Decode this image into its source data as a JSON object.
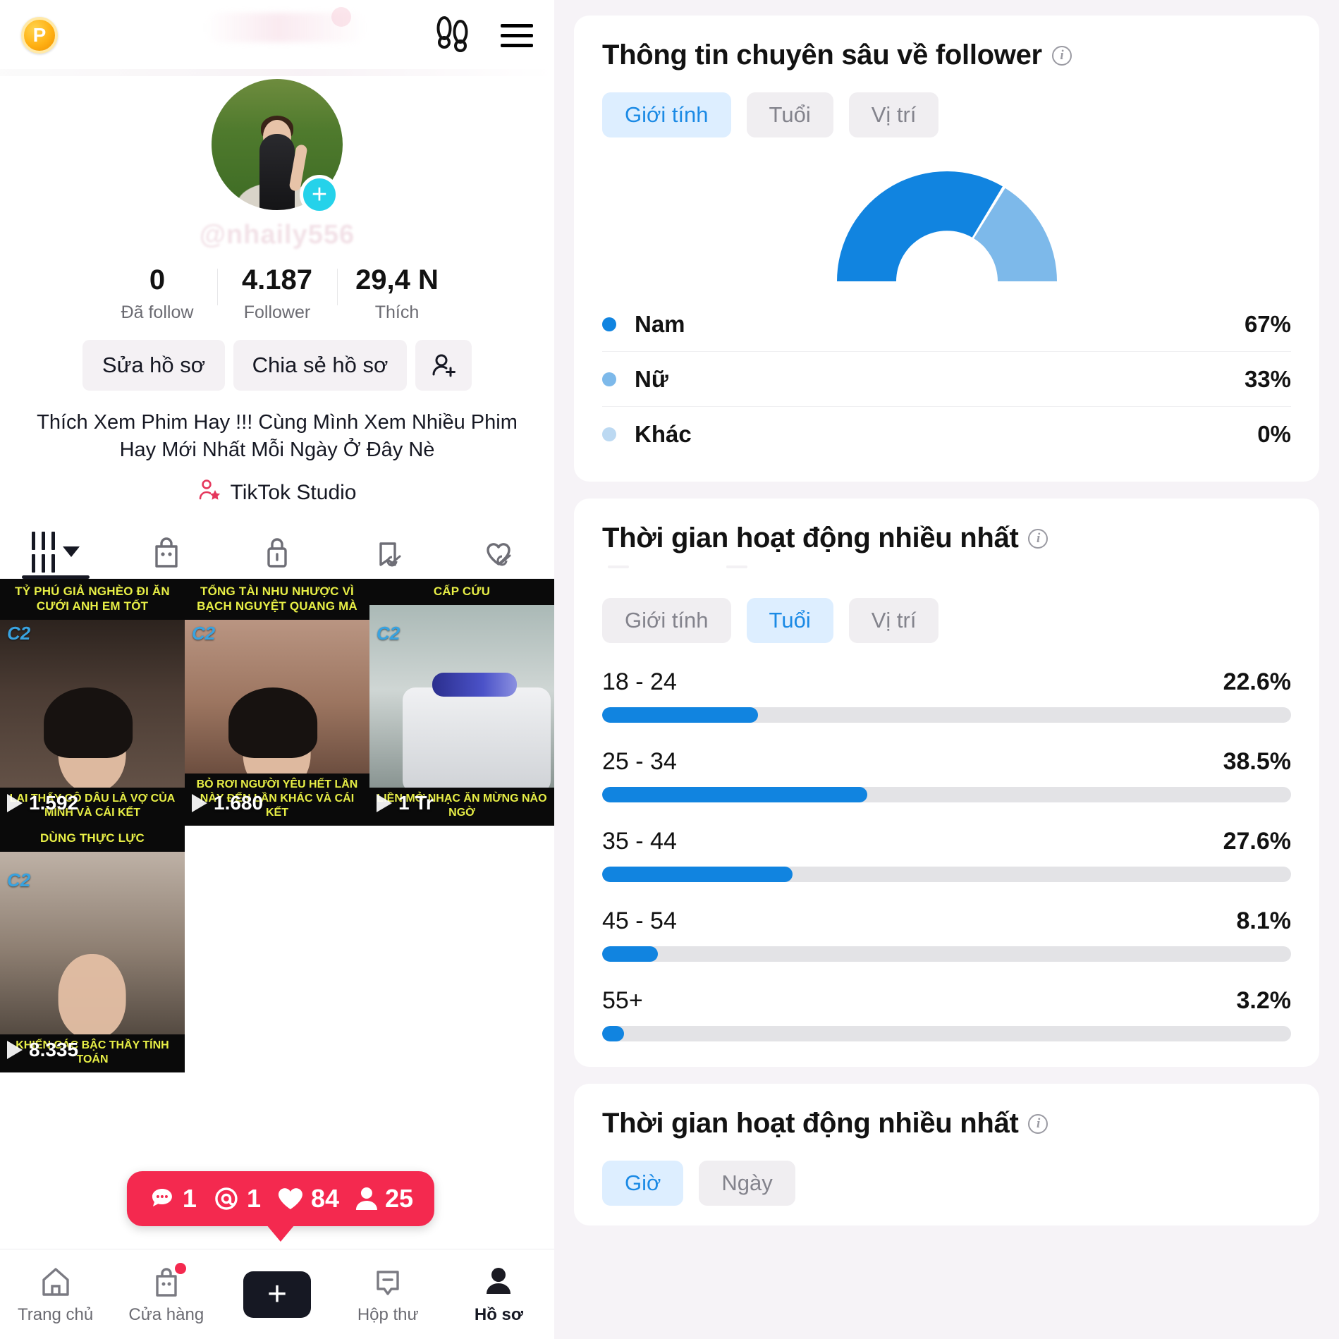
{
  "phone": {
    "header": {
      "coin_label": "P",
      "footsteps_icon": "footsteps-icon",
      "menu_icon": "hamburger-menu-icon"
    },
    "profile": {
      "username_ghost": "@nhaily556",
      "add_story_icon": "plus-icon",
      "stats": [
        {
          "value": "0",
          "label": "Đã follow"
        },
        {
          "value": "4.187",
          "label": "Follower"
        },
        {
          "value": "29,4 N",
          "label": "Thích"
        }
      ],
      "actions": {
        "edit": "Sửa hồ sơ",
        "share": "Chia sẻ hồ sơ",
        "add_friend_icon": "add-user-icon"
      },
      "bio": "Thích Xem Phim Hay !!! Cùng Mình Xem Nhiều Phim Hay Mới Nhất Mỗi Ngày Ở Đây Nè",
      "studio_label": "TikTok Studio"
    },
    "content_tabs": [
      {
        "icon": "grid-posts-icon",
        "active": true
      },
      {
        "icon": "shop-bag-icon",
        "active": false
      },
      {
        "icon": "lock-private-icon",
        "active": false
      },
      {
        "icon": "bookmark-hidden-icon",
        "active": false
      },
      {
        "icon": "heart-hidden-icon",
        "active": false
      }
    ],
    "videos": [
      {
        "cap_top": "TỶ PHÚ GIẢ NGHÈO ĐI ĂN CƯỚI ANH EM TỐT",
        "cap_bottom": "LẠI THẤY CÔ DÂU LÀ VỢ CỦA MÌNH VÀ CÁI KẾT",
        "views": "1.592",
        "watermark": "C2"
      },
      {
        "cap_top": "TỔNG TÀI NHU NHƯỢC VÌ BẠCH NGUYỆT QUANG MÀ",
        "cap_bottom": "BỎ RƠI NGƯỜI YÊU HẾT LẦN NÀY ĐẾN LẦN KHÁC VÀ CÁI KẾT",
        "views": "1.680",
        "watermark": "C2"
      },
      {
        "cap_top": "CẤP CỨU",
        "cap_bottom": "LIỀN MỞ NHẠC ĂN MỪNG NÀO NGỜ",
        "views": "1 Tr",
        "watermark": "C2"
      },
      {
        "cap_top": "DÙNG THỰC LỰC",
        "cap_bottom": "KHIẾN CÁC BẬC THẦY TÍNH TOÁN",
        "views": "8.335",
        "watermark": "C2"
      }
    ],
    "toast": {
      "comments_icon": "comment-icon",
      "comments": "1",
      "mentions_icon": "mention-icon",
      "mentions": "1",
      "likes_icon": "heart-icon",
      "likes": "84",
      "followers_icon": "person-icon",
      "followers": "25",
      "color": "#f4294f"
    },
    "bottom_nav": [
      {
        "label": "Trang chủ",
        "icon": "home-icon",
        "active": false,
        "badge": false
      },
      {
        "label": "Cửa hàng",
        "icon": "shop-bag-icon",
        "active": false,
        "badge": true
      },
      {
        "label": "",
        "icon": "create-plus-icon",
        "active": false,
        "badge": false
      },
      {
        "label": "Hộp thư",
        "icon": "inbox-icon",
        "active": false,
        "badge": false
      },
      {
        "label": "Hồ sơ",
        "icon": "profile-person-icon",
        "active": true,
        "badge": false
      }
    ]
  },
  "analytics": {
    "cards": [
      {
        "title": "Thông tin chuyên sâu về follower",
        "info_icon": "info-icon",
        "segments": [
          {
            "label": "Giới tính",
            "active": true
          },
          {
            "label": "Tuổi",
            "active": false
          },
          {
            "label": "Vị trí",
            "active": false
          }
        ]
      },
      {
        "title": "Thời gian hoạt động nhiều nhất",
        "info_icon": "info-icon",
        "segments": [
          {
            "label": "Giới tính",
            "active": false
          },
          {
            "label": "Tuổi",
            "active": true
          },
          {
            "label": "Vị trí",
            "active": false
          }
        ]
      },
      {
        "title": "Thời gian hoạt động nhiều nhất",
        "info_icon": "info-icon",
        "segments": [
          {
            "label": "Giờ",
            "active": true
          },
          {
            "label": "Ngày",
            "active": false
          }
        ]
      }
    ]
  },
  "colors": {
    "primary_blue": "#1184e0",
    "light_blue": "#7db9ea",
    "pale_blue": "#bcd9f2",
    "seg_active_bg": "#ddeeff",
    "seg_active_text": "#1b8ae5",
    "track_grey": "#e3e3e6",
    "toast_red": "#f4294f",
    "tiktok_cyan": "#25f4ee",
    "tiktok_pink": "#fe2c55"
  },
  "chart_data": [
    {
      "type": "pie",
      "title": "Thông tin chuyên sâu về follower",
      "subtitle": "Giới tính",
      "shape": "semicircle-donut",
      "labels": [
        "Nam",
        "Nữ",
        "Khác"
      ],
      "values": [
        67,
        33,
        0
      ],
      "display_values": [
        "67%",
        "33%",
        "0%"
      ],
      "colors": [
        "#1184e0",
        "#7db9ea",
        "#bcd9f2"
      ],
      "legend": "bottom-list",
      "units": "percent"
    },
    {
      "type": "bar",
      "orientation": "horizontal",
      "title": "Thời gian hoạt động nhiều nhất",
      "subtitle": "Tuổi",
      "categories": [
        "18 - 24",
        "25 - 34",
        "35 - 44",
        "45 - 54",
        "55+"
      ],
      "values": [
        22.6,
        38.5,
        27.6,
        8.1,
        3.2
      ],
      "display_values": [
        "22.6%",
        "38.5%",
        "27.6%",
        "8.1%",
        "3.2%"
      ],
      "xlabel": "",
      "ylabel": "",
      "xlim": [
        0,
        100
      ],
      "grid": false,
      "legend": "none",
      "bar_color": "#1184e0",
      "track_color": "#e3e3e6",
      "units": "percent"
    }
  ]
}
